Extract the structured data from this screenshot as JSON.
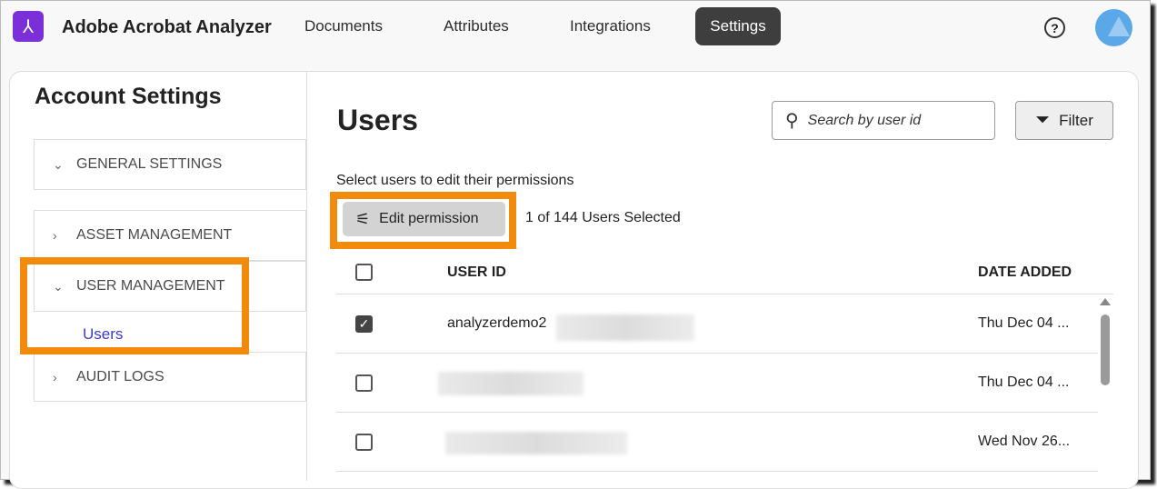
{
  "header": {
    "app_title": "Adobe Acrobat Analyzer",
    "nav": [
      "Documents",
      "Attributes",
      "Integrations",
      "Settings"
    ],
    "active_nav": "Settings",
    "help_label": "?"
  },
  "sidebar": {
    "title": "Account Settings",
    "sections": [
      "GENERAL SETTINGS",
      "ASSET MANAGEMENT",
      "USER MANAGEMENT",
      "AUDIT LOGS"
    ],
    "sub_item": "Users"
  },
  "main": {
    "title": "Users",
    "search_placeholder": "Search by user id",
    "filter_label": "Filter",
    "hint": "Select users to edit their permissions",
    "edit_button": "Edit permission",
    "selection_count": "1 of 144 Users Selected",
    "columns": [
      "USER ID",
      "DATE ADDED"
    ],
    "rows": [
      {
        "user_id": "analyzerdemo2",
        "date": "Thu Dec 04 ...",
        "checked": true
      },
      {
        "user_id": "",
        "date": "Thu Dec 04 ...",
        "checked": false
      },
      {
        "user_id": "",
        "date": "Wed Nov 26...",
        "checked": false
      }
    ]
  },
  "colors": {
    "accent": "#f28a0c",
    "brand": "#7a2fd8",
    "link": "#3b3bd1"
  }
}
